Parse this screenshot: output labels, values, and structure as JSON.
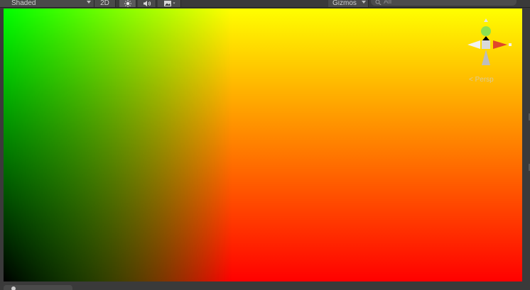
{
  "toolbar": {
    "shading_mode": "Shaded",
    "mode_2d": "2D",
    "gizmos_label": "Gizmos",
    "search_placeholder": "All"
  },
  "icons": {
    "lighting": "sun-icon",
    "audio": "speaker-icon",
    "effects": "image-icon",
    "gizmos_caret": "chevron-down-icon",
    "search": "search-icon"
  },
  "viewport": {
    "colors": {
      "top_left": "#00ff00",
      "top_right": "#ffff00",
      "bottom_right": "#ff0000",
      "bottom_left": "#000000"
    }
  },
  "gizmo": {
    "projection_label": "Persp",
    "axis_colors": {
      "x": "#e0462a",
      "y": "#8ee04e",
      "z": "#4c78e8",
      "neutral": "#c8c8c8"
    }
  }
}
